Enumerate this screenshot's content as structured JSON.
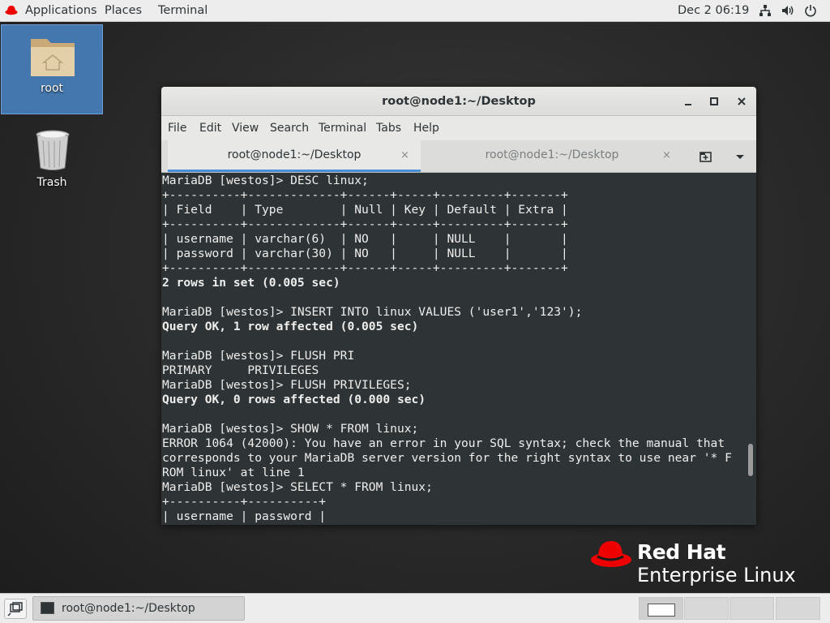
{
  "topbar": {
    "applications": "Applications",
    "places": "Places",
    "terminal": "Terminal",
    "clock": "Dec 2  06:19",
    "tray_icons": [
      "network-icon",
      "volume-icon",
      "power-icon"
    ]
  },
  "desktop": {
    "home_label": "root",
    "trash_label": "Trash"
  },
  "window": {
    "title": "root@node1:~/Desktop",
    "menu": [
      "File",
      "Edit",
      "View",
      "Search",
      "Terminal",
      "Tabs",
      "Help"
    ],
    "tabs": [
      {
        "label": "root@node1:~/Desktop",
        "active": true
      },
      {
        "label": "root@node1:~/Desktop",
        "active": false
      }
    ],
    "close_glyph": "×",
    "lines": [
      {
        "text": "MariaDB [westos]> DESC linux;",
        "bold": false
      },
      {
        "text": "+----------+-------------+------+-----+---------+-------+",
        "bold": false
      },
      {
        "text": "| Field    | Type        | Null | Key | Default | Extra |",
        "bold": false
      },
      {
        "text": "+----------+-------------+------+-----+---------+-------+",
        "bold": false
      },
      {
        "text": "| username | varchar(6)  | NO   |     | NULL    |       |",
        "bold": false
      },
      {
        "text": "| password | varchar(30) | NO   |     | NULL    |       |",
        "bold": false
      },
      {
        "text": "+----------+-------------+------+-----+---------+-------+",
        "bold": false
      },
      {
        "text": "2 rows in set (0.005 sec)",
        "bold": true
      },
      {
        "text": "",
        "bold": false
      },
      {
        "text": "MariaDB [westos]> INSERT INTO linux VALUES ('user1','123');",
        "bold": false
      },
      {
        "text": "Query OK, 1 row affected (0.005 sec)",
        "bold": true
      },
      {
        "text": "",
        "bold": false
      },
      {
        "text": "MariaDB [westos]> FLUSH PRI",
        "bold": false
      },
      {
        "text": "PRIMARY     PRIVILEGES",
        "bold": false
      },
      {
        "text": "MariaDB [westos]> FLUSH PRIVILEGES;",
        "bold": false
      },
      {
        "text": "Query OK, 0 rows affected (0.000 sec)",
        "bold": true
      },
      {
        "text": "",
        "bold": false
      },
      {
        "text": "MariaDB [westos]> SHOW * FROM linux;",
        "bold": false
      },
      {
        "text": "ERROR 1064 (42000): You have an error in your SQL syntax; check the manual that",
        "bold": false
      },
      {
        "text": "corresponds to your MariaDB server version for the right syntax to use near '* F",
        "bold": false
      },
      {
        "text": "ROM linux' at line 1",
        "bold": false
      },
      {
        "text": "MariaDB [westos]> SELECT * FROM linux;",
        "bold": false
      },
      {
        "text": "+----------+----------+",
        "bold": false
      },
      {
        "text": "| username | password |",
        "bold": false
      }
    ]
  },
  "logo": {
    "line1": "Red Hat",
    "line2": "Enterprise Linux"
  },
  "taskbar": {
    "task_label": "root@node1:~/Desktop",
    "workspaces": 4,
    "active_workspace": 1
  }
}
